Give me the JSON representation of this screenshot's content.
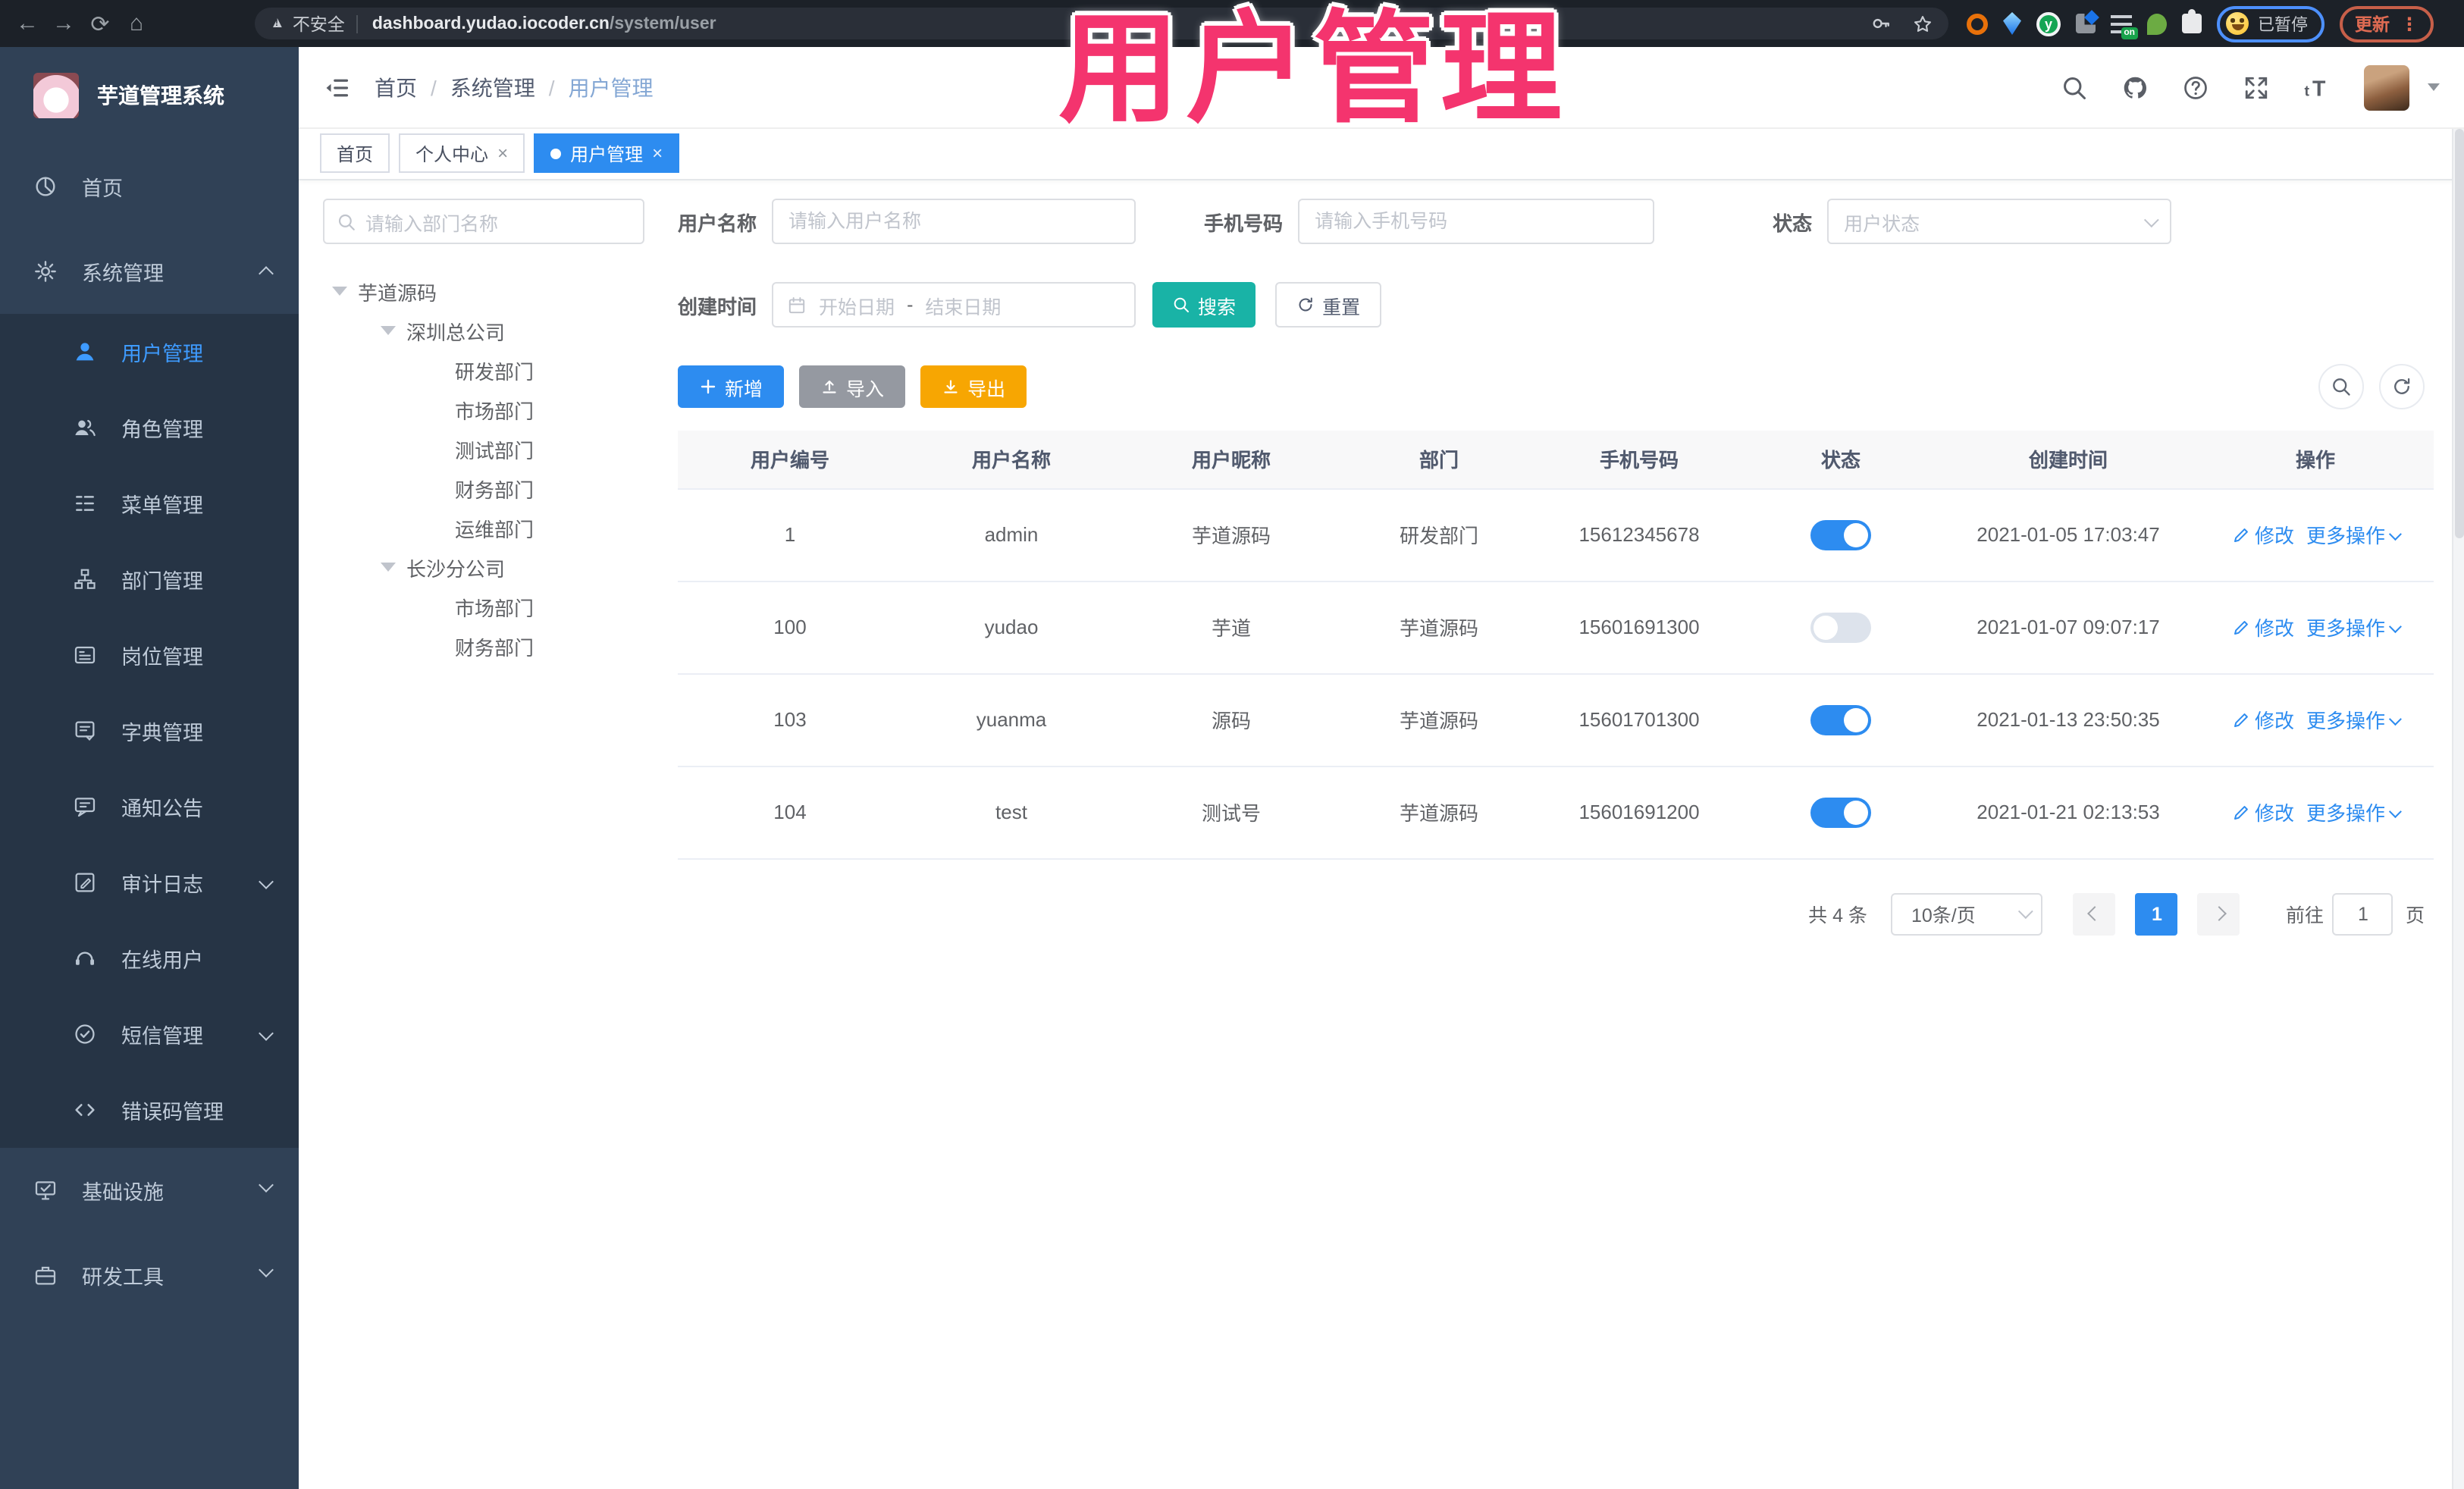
{
  "browser": {
    "security_label": "不安全",
    "url_host": "dashboard.yudao.iocoder.cn",
    "url_path": "/system/user",
    "ext_on_badge": "on",
    "profile_status": "已暂停",
    "update_label": "更新"
  },
  "overlay": {
    "title": "用户管理",
    "color": "#f4346e"
  },
  "sidebar": {
    "logo_title": "芋道管理系统",
    "items": [
      {
        "label": "首页",
        "icon": "dashboard-icon"
      },
      {
        "label": "系统管理",
        "icon": "gear-icon",
        "chevron": "up"
      },
      {
        "label": "用户管理",
        "icon": "user-icon",
        "active": true
      },
      {
        "label": "角色管理",
        "icon": "users-icon"
      },
      {
        "label": "菜单管理",
        "icon": "menu-tree-icon"
      },
      {
        "label": "部门管理",
        "icon": "org-chart-icon"
      },
      {
        "label": "岗位管理",
        "icon": "badge-icon"
      },
      {
        "label": "字典管理",
        "icon": "dictionary-icon"
      },
      {
        "label": "通知公告",
        "icon": "announcement-icon"
      },
      {
        "label": "审计日志",
        "icon": "audit-log-icon",
        "chevron": "down"
      },
      {
        "label": "在线用户",
        "icon": "online-users-icon"
      },
      {
        "label": "短信管理",
        "icon": "sms-icon",
        "chevron": "down"
      },
      {
        "label": "错误码管理",
        "icon": "code-icon"
      },
      {
        "label": "基础设施",
        "icon": "infrastructure-icon",
        "chevron": "down"
      },
      {
        "label": "研发工具",
        "icon": "dev-tools-icon",
        "chevron": "down"
      }
    ]
  },
  "header": {
    "breadcrumb": [
      "首页",
      "系统管理",
      "用户管理"
    ]
  },
  "tabs": [
    {
      "label": "首页"
    },
    {
      "label": "个人中心",
      "close": "×"
    },
    {
      "label": "用户管理",
      "close": "×",
      "active": true
    }
  ],
  "dept": {
    "search_placeholder": "请输入部门名称",
    "tree": [
      {
        "label": "芋道源码"
      },
      {
        "label": "深圳总公司"
      },
      {
        "label": "研发部门"
      },
      {
        "label": "市场部门"
      },
      {
        "label": "测试部门"
      },
      {
        "label": "财务部门"
      },
      {
        "label": "运维部门"
      },
      {
        "label": "长沙分公司"
      },
      {
        "label": "市场部门"
      },
      {
        "label": "财务部门"
      }
    ]
  },
  "filters": {
    "username_label": "用户名称",
    "username_placeholder": "请输入用户名称",
    "mobile_label": "手机号码",
    "mobile_placeholder": "请输入手机号码",
    "status_label": "状态",
    "status_placeholder": "用户状态",
    "date_label": "创建时间",
    "date_start_placeholder": "开始日期",
    "date_separator": "-",
    "date_end_placeholder": "结束日期",
    "search_label": "搜索",
    "reset_label": "重置"
  },
  "toolbar": {
    "add_label": "新增",
    "import_label": "导入",
    "export_label": "导出"
  },
  "table": {
    "headers": [
      "用户编号",
      "用户名称",
      "用户昵称",
      "部门",
      "手机号码",
      "状态",
      "创建时间",
      "操作"
    ],
    "actions": {
      "edit": "修改",
      "more": "更多操作"
    },
    "rows": [
      {
        "id": "1",
        "username": "admin",
        "nickname": "芋道源码",
        "dept": "研发部门",
        "mobile": "15612345678",
        "status": true,
        "created": "2021-01-05 17:03:47"
      },
      {
        "id": "100",
        "username": "yudao",
        "nickname": "芋道",
        "dept": "芋道源码",
        "mobile": "15601691300",
        "status": false,
        "created": "2021-01-07 09:07:17"
      },
      {
        "id": "103",
        "username": "yuanma",
        "nickname": "源码",
        "dept": "芋道源码",
        "mobile": "15601701300",
        "status": true,
        "created": "2021-01-13 23:50:35"
      },
      {
        "id": "104",
        "username": "test",
        "nickname": "测试号",
        "dept": "芋道源码",
        "mobile": "15601691200",
        "status": true,
        "created": "2021-01-21 02:13:53"
      }
    ]
  },
  "pagination": {
    "total": "共 4 条",
    "page_size": "10条/页",
    "current_page": "1",
    "goto_label": "前往",
    "goto_value": "1",
    "page_unit": "页"
  },
  "colors": {
    "accent": "#2d8cf0",
    "search_teal": "#19b3a6",
    "export_orange": "#f7a602",
    "sidebar_bg": "#304156",
    "submenu_bg": "#263445",
    "overlay_pink": "#f4346e"
  }
}
